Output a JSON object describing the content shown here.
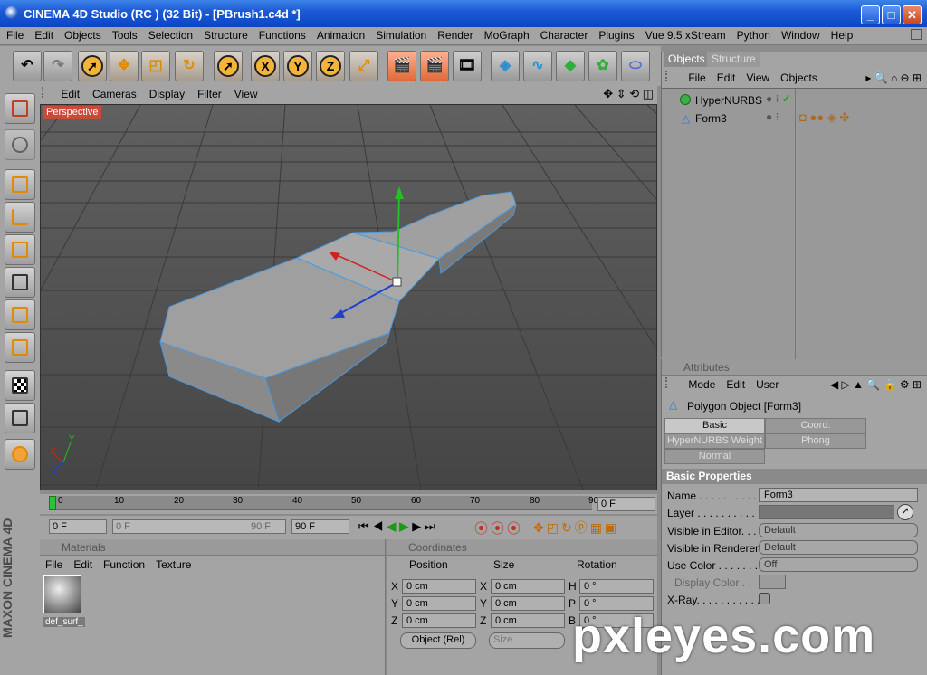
{
  "window": {
    "title": "CINEMA 4D Studio (RC ) (32 Bit) - [PBrush1.c4d *]",
    "min": "_",
    "max": "□",
    "close": "✕"
  },
  "menu": [
    "File",
    "Edit",
    "Objects",
    "Tools",
    "Selection",
    "Structure",
    "Functions",
    "Animation",
    "Simulation",
    "Render",
    "MoGraph",
    "Character",
    "Plugins",
    "Vue 9.5 xStream",
    "Python",
    "Window",
    "Help"
  ],
  "toolbar": {
    "x": "X",
    "y": "Y",
    "z": "Z"
  },
  "viewport": {
    "menu": [
      "Edit",
      "Cameras",
      "Display",
      "Filter",
      "View"
    ],
    "label": "Perspective",
    "axis_x": "X",
    "axis_y": "Y",
    "axis_z": "Z"
  },
  "timeline": {
    "ticks": [
      "0",
      "10",
      "20",
      "30",
      "40",
      "50",
      "60",
      "70",
      "80",
      "90"
    ],
    "current": "0 F"
  },
  "transport": {
    "start": "0 F",
    "range_start": "0 F",
    "range_end": "90 F",
    "end": "90 F"
  },
  "materials": {
    "title": "Materials",
    "menu": [
      "File",
      "Edit",
      "Function",
      "Texture"
    ],
    "items": [
      "def_surf_"
    ]
  },
  "coordinates": {
    "title": "Coordinates",
    "headers": [
      "Position",
      "Size",
      "Rotation"
    ],
    "rows": [
      {
        "a": "X",
        "pos": "0 cm",
        "b": "X",
        "size": "0 cm",
        "c": "H",
        "rot": "0 °"
      },
      {
        "a": "Y",
        "pos": "0 cm",
        "b": "Y",
        "size": "0 cm",
        "c": "P",
        "rot": "0 °"
      },
      {
        "a": "Z",
        "pos": "0 cm",
        "b": "Z",
        "size": "0 cm",
        "c": "B",
        "rot": "0 °"
      }
    ],
    "mode": "Object (Rel)",
    "size_mode": "Size"
  },
  "objects": {
    "tabs": [
      "Objects",
      "Structure"
    ],
    "menu": [
      "File",
      "Edit",
      "View",
      "Objects"
    ],
    "items": [
      "HyperNURBS",
      "Form3"
    ]
  },
  "attributes": {
    "title": "Attributes",
    "menu": [
      "Mode",
      "Edit",
      "User"
    ],
    "object": "Polygon Object [Form3]",
    "tabs": [
      "Basic",
      "Coord.",
      "HyperNURBS Weight",
      "Phong",
      "Normal"
    ],
    "section": "Basic Properties",
    "props": [
      {
        "label": "Name . . . . . . . . . . .",
        "value": "Form3"
      },
      {
        "label": "Layer . . . . . . . . . . .",
        "value": ""
      },
      {
        "label": "Visible in Editor. . .",
        "value": "Default"
      },
      {
        "label": "Visible in Renderer",
        "value": "Default"
      },
      {
        "label": "Use Color . . . . . . .",
        "value": "Off"
      },
      {
        "label": "Display Color . .",
        "value": ""
      },
      {
        "label": "X-Ray. . . . . . . . . . .",
        "value": ""
      }
    ]
  },
  "brand": "MAXON CINEMA 4D",
  "watermark": "pxleyes.com"
}
